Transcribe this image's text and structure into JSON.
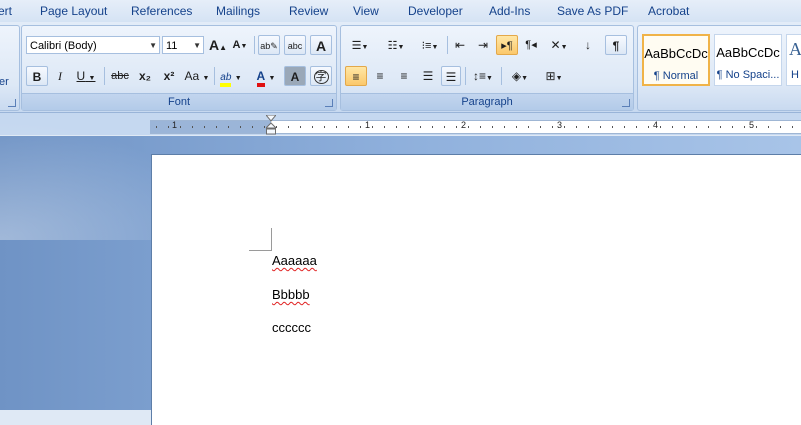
{
  "tabs": [
    "ert",
    "Page Layout",
    "References",
    "Mailings",
    "Review",
    "View",
    "Developer",
    "Add-Ins",
    "Save As PDF",
    "Acrobat"
  ],
  "ribbon": {
    "left_partial_label": "er",
    "font_group": {
      "label": "Font",
      "font_name": "Calibri (Body)",
      "font_size": "11",
      "grow_font": "A",
      "shrink_font": "A",
      "bold": "B",
      "italic": "I",
      "underline": "U",
      "strikethrough": "abc",
      "subscript": "x₂",
      "superscript": "x²",
      "change_case": "Aa",
      "highlight": "ab",
      "font_color": "A",
      "char_shading": "A",
      "enclose": "字"
    },
    "paragraph_group": {
      "label": "Paragraph",
      "show_marks": "¶"
    },
    "styles": [
      {
        "sample": "AaBbCcDc",
        "name": "¶ Normal"
      },
      {
        "sample": "AaBbCcDc",
        "name": "¶ No Spaci..."
      },
      {
        "sample": "A",
        "name": "H"
      }
    ]
  },
  "ruler": {
    "numbers": [
      "1",
      "1",
      "2",
      "3",
      "4",
      "5"
    ]
  },
  "document": {
    "paragraphs": [
      "Aaaaaa",
      "Bbbbb",
      "cccccc"
    ]
  },
  "colors": {
    "highlight_yellow": "#ffff00",
    "font_color_red": "#e01010",
    "active_button": "#fbc86b"
  }
}
